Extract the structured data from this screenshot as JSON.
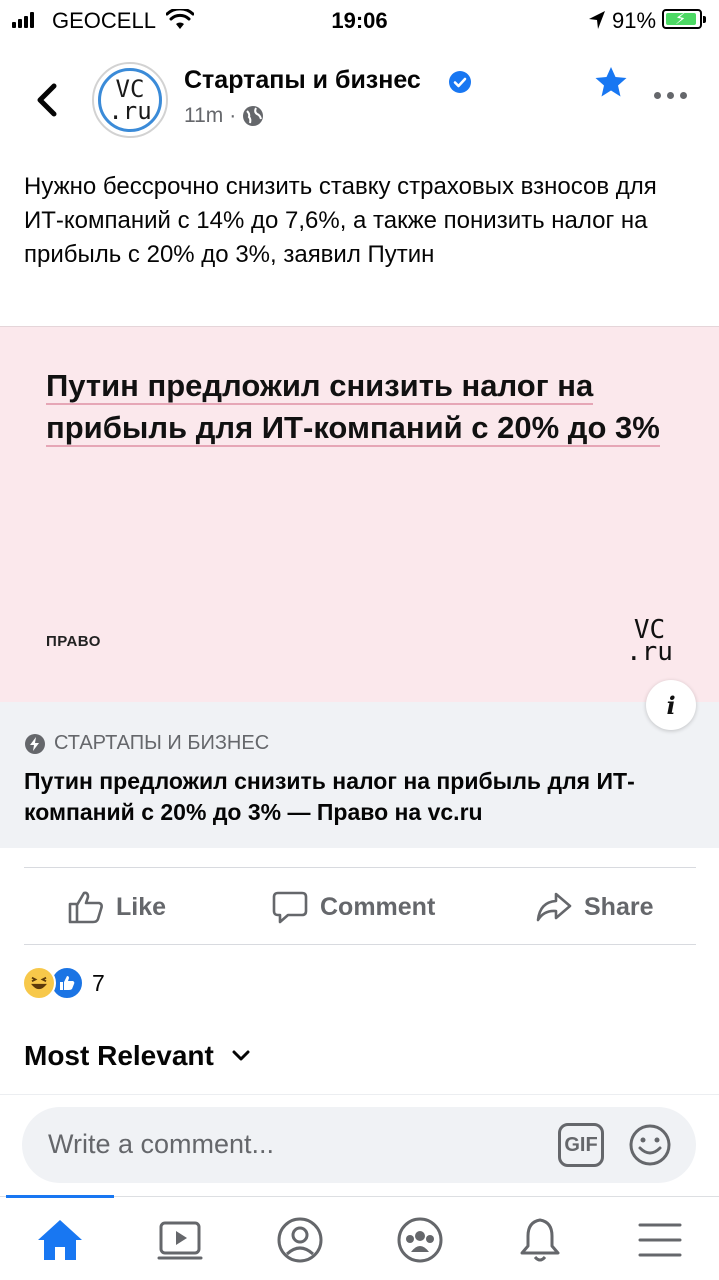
{
  "status_bar": {
    "carrier": "GEOCELL",
    "time": "19:06",
    "battery": "91%"
  },
  "header": {
    "page_name": "Стартапы и бизнес",
    "time_ago": "11m",
    "separator": "·",
    "avatar_line1": "VC",
    "avatar_line2": ".ru"
  },
  "post": {
    "text": "Нужно бессрочно снизить ставку страховых взносов для ИТ-компаний с 14% до 7,6%, а также понизить налог на прибыль с 20% до 3%, заявил Путин"
  },
  "preview": {
    "headline": "Путин предложил снизить налог на прибыль для ИТ-компаний с 20% до 3%",
    "category": "ПРАВО",
    "logo_line1": "VC",
    "logo_line2": ".ru",
    "info": "i"
  },
  "link": {
    "source": "СТАРТАПЫ И БИЗНЕС",
    "title": "Путин предложил снизить налог на прибыль для ИТ-компаний с 20% до 3% — Право на vc.ru"
  },
  "actions": {
    "like": "Like",
    "comment": "Comment",
    "share": "Share"
  },
  "reactions": {
    "count": "7"
  },
  "comments": {
    "sort_label": "Most Relevant",
    "placeholder": "Write a comment...",
    "gif_label": "GIF"
  },
  "colors": {
    "accent": "#1877f2",
    "preview_bg": "#fbe8ec",
    "link_bg": "#f0f2f5",
    "secondary_text": "#65676b"
  }
}
